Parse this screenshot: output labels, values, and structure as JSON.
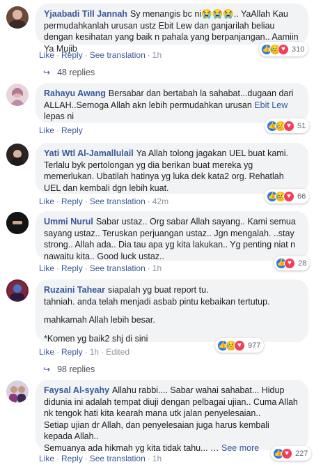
{
  "comments": [
    {
      "author": "Yjaabadi Till Jannah",
      "text_parts": [
        "Sy menangis bc ni😭😭😭.. YaAllah Kau permudahkanlah urusan ustz Ebit Lew dan ganjarilah beliau dengan kesihatan yang baik n pahala yang berpanjangan.. Aamiin Ya Mujib"
      ],
      "time": "1h",
      "reaction_count": "310",
      "reactions": [
        "like",
        "sad",
        "love"
      ],
      "replies": "48 replies",
      "avatar_color": "#6b4a3a"
    },
    {
      "author": "Rahayu Awang",
      "text_before_link": "Bersabar dan bertabah la sahabat...dugaan dari ALLAH..Semoga Allah akn lebih permudahkan urusan ",
      "link": "Ebit Lew",
      "text_after_link": " lepas ni",
      "time": "",
      "reaction_count": "51",
      "reactions": [
        "like",
        "sad",
        "love"
      ],
      "avatar_color": "#c9a2b4"
    },
    {
      "author": "Yati Wtl Al-Jamallulail",
      "text_parts": [
        "Ya Allah tolong jagakan UEL buat kami. Terlalu byk pertolongan yg dia berikan buat mereka yg memerlukan. Ubatilah hatinya yg luka dek kata2 org. Rehatlah UEL dan kembali dgn lebih kuat."
      ],
      "time": "42m",
      "reaction_count": "66",
      "reactions": [
        "like",
        "sad",
        "love"
      ],
      "avatar_color": "#3a3030"
    },
    {
      "author": "Ummi Nurul",
      "text_parts": [
        "Sabar ustaz.. Org sabar Allah sayang.. Kami semua sayang ustaz.. Teruskan perjuangan ustaz.. Jgn mengalah. ..stay strong.. Allah ada.. Dia tau apa yg kita lakukan.. Yg penting niat n nawaitu kita.. Good luck ustaz.."
      ],
      "time": "1h",
      "reaction_count": "28",
      "reactions": [
        "like",
        "love"
      ],
      "avatar_color": "#1a1a1a"
    },
    {
      "author": "Ruzaini Tahear",
      "text_parts": [
        "siapalah yg buat report tu.",
        "tahniah. anda telah menjadi asbab pintu kebaikan tertutup.",
        "mahkamah Allah lebih besar.",
        "*Komen yg baik2 shj di sini"
      ],
      "time": "1h",
      "edited": "Edited",
      "reaction_count": "977",
      "reactions": [
        "like",
        "sad",
        "love"
      ],
      "replies": "98 replies",
      "avatar_color": "#7a2a40"
    },
    {
      "author": "Faysal Al-syahy",
      "text_parts": [
        "Allahu rabbi.... Sabar wahai sahabat... Hidup didunia ini adalah tempat diuji dengan pelbagai ujian.. Cuma Allah nk tengok hati kita kearah mana utk jalan penyelesaian..",
        "Setiap ujian dr Allah, dan penyelesaian juga harus kembali kepada Allah..",
        "Semuanya ada hikmah yg kita tidak tahu... …"
      ],
      "see_more": "See more",
      "time": "1h",
      "reaction_count": "227",
      "reactions": [
        "like",
        "love"
      ],
      "avatar_color": "#8a6a9a"
    }
  ],
  "actions": {
    "like": "Like",
    "reply": "Reply",
    "translate": "See translation",
    "sep": "·"
  },
  "icons": {
    "like": "👍",
    "love": "♥",
    "sad": "😥",
    "reply_arrow": "↪"
  },
  "colors": {
    "link": "#385898",
    "bubble": "#f2f3f5",
    "like": "#2078f4",
    "love": "#f33e58",
    "sad": "#f7b125"
  }
}
